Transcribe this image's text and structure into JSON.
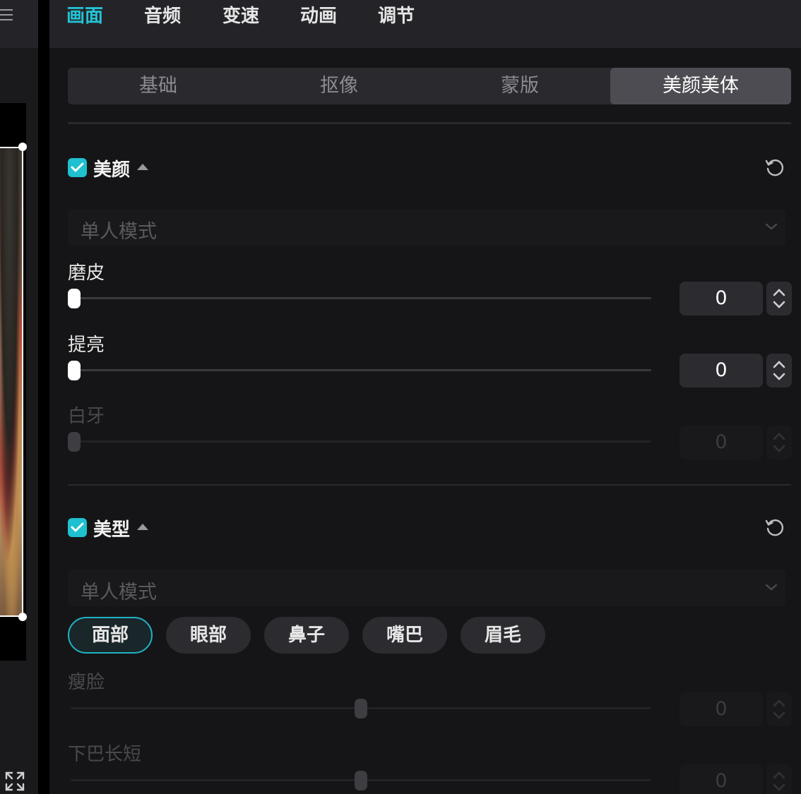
{
  "top_tabs": [
    {
      "label": "画面",
      "active": true
    },
    {
      "label": "音频",
      "active": false
    },
    {
      "label": "变速",
      "active": false
    },
    {
      "label": "动画",
      "active": false
    },
    {
      "label": "调节",
      "active": false
    }
  ],
  "sub_tabs": [
    {
      "label": "基础",
      "active": false
    },
    {
      "label": "抠像",
      "active": false
    },
    {
      "label": "蒙版",
      "active": false
    },
    {
      "label": "美颜美体",
      "active": true
    }
  ],
  "beauty": {
    "title": "美颜",
    "checked": true,
    "mode_select": "单人模式",
    "params": [
      {
        "label": "磨皮",
        "value": "0",
        "level": 0,
        "enabled": true
      },
      {
        "label": "提亮",
        "value": "0",
        "level": 0,
        "enabled": true
      },
      {
        "label": "白牙",
        "value": "0",
        "level": 0,
        "enabled": false
      }
    ]
  },
  "shape": {
    "title": "美型",
    "checked": true,
    "mode_select": "单人模式",
    "pills": [
      {
        "label": "面部",
        "active": true
      },
      {
        "label": "眼部",
        "active": false
      },
      {
        "label": "鼻子",
        "active": false
      },
      {
        "label": "嘴巴",
        "active": false
      },
      {
        "label": "眉毛",
        "active": false
      }
    ],
    "params": [
      {
        "label": "瘦脸",
        "value": "0",
        "level": 0.5,
        "enabled": false
      },
      {
        "label": "下巴长短",
        "value": "0",
        "level": 0.5,
        "enabled": false
      }
    ]
  },
  "icons": {
    "menu": "menu-icon",
    "fullscreen": "fullscreen-icon",
    "reset": "reset-icon",
    "check": "check-icon",
    "chevron": "chevron-down-icon",
    "stepper": "stepper-icon"
  },
  "colors": {
    "accent": "#1fc0cf",
    "panel_bg": "#151517",
    "tab_bar_bg": "#242428"
  }
}
